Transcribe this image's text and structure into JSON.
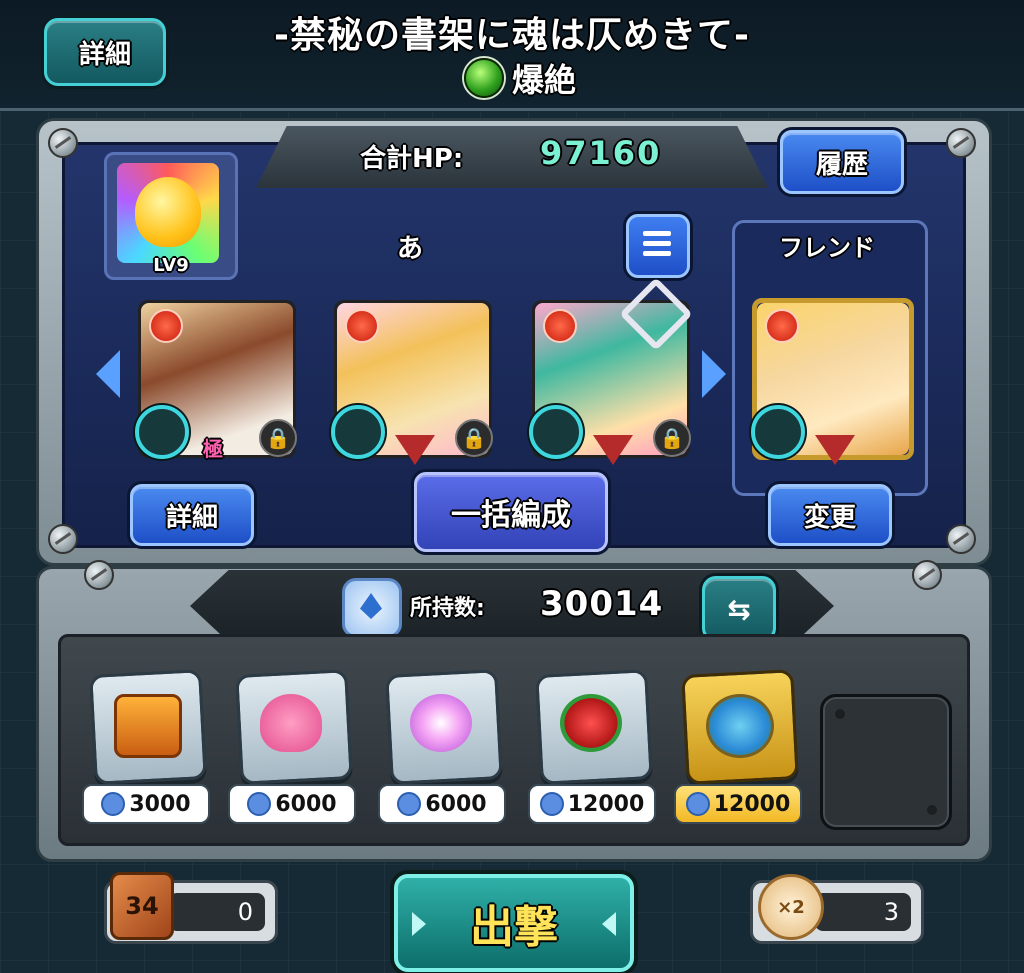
{
  "header": {
    "detail_button": "詳細",
    "stage_title": "-禁秘の書架に魂は仄めきて-",
    "difficulty": "爆絶"
  },
  "party": {
    "total_hp_label": "合計HP:",
    "total_hp_value": "97160",
    "history_button": "履歴",
    "leader_level": "LV9",
    "deck_name": "あ",
    "friend_label": "フレンド",
    "member_badge": "極",
    "detail_button": "詳細",
    "batch_edit_button": "一括編成",
    "change_button": "変更"
  },
  "currency": {
    "label": "所持数:",
    "value": "30014"
  },
  "shop_items": [
    {
      "name": "treasure-chest",
      "price": "3000"
    },
    {
      "name": "heart",
      "price": "6000"
    },
    {
      "name": "speed-orb",
      "price": "6000"
    },
    {
      "name": "strawberry",
      "price": "12000"
    },
    {
      "name": "compass",
      "price": "12000"
    }
  ],
  "bottom": {
    "dice_label": "34",
    "dice_count": "0",
    "sortie_button": "出撃",
    "boost_label": "×2",
    "boost_count": "3"
  }
}
